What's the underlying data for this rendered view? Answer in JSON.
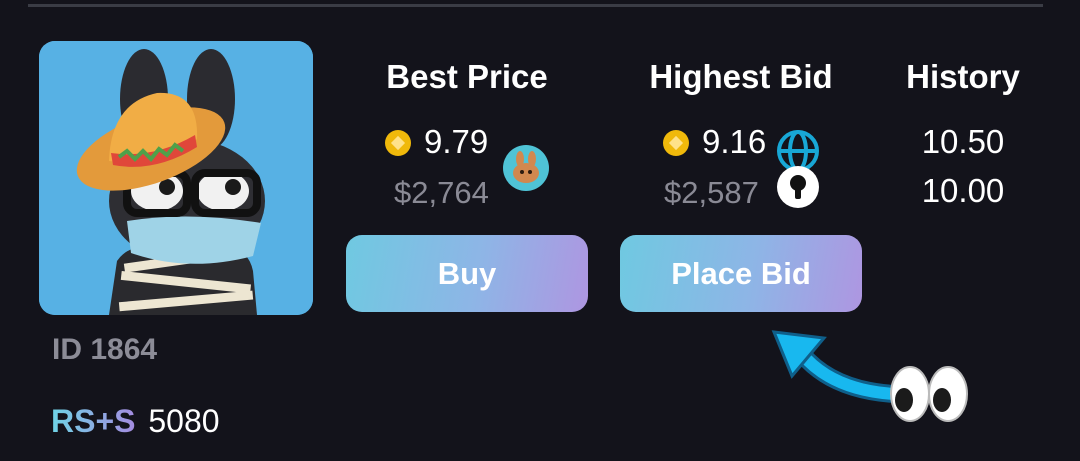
{
  "nft": {
    "id_label": "ID 1864",
    "rs_label": "RS+S",
    "rs_value": "5080"
  },
  "best_price": {
    "title": "Best Price",
    "price": "9.79",
    "usd": "$2,764",
    "button_label": "Buy",
    "marketplace_icon": "pancakeswap-bunny-icon"
  },
  "highest_bid": {
    "title": "Highest Bid",
    "price": "9.16",
    "usd": "$2,587",
    "button_label": "Place Bid",
    "network_icon": "globe-icon",
    "lock_icon": "keyhole-icon"
  },
  "history": {
    "title": "History",
    "values": [
      "10.50",
      "10.00"
    ]
  },
  "colors": {
    "background": "#13131b",
    "card": "#57b1e4",
    "coin": "#f0b90b",
    "button_gradient_start": "#6fc9e1",
    "button_gradient_end": "#ae96e1",
    "arrow": "#16b3ec"
  },
  "annotations": {
    "arrow_icon": "curved-arrow-icon",
    "eyes_icon": "eyes-emoji-icon"
  }
}
